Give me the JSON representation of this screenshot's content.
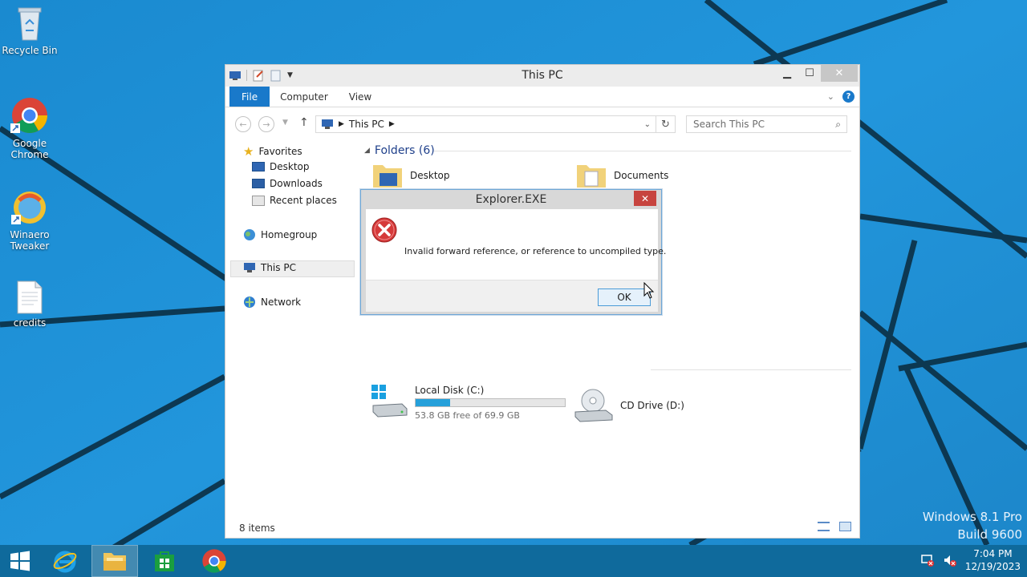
{
  "desktop": {
    "icons": [
      {
        "label": "Recycle Bin",
        "icon": "recycle-bin-icon"
      },
      {
        "label": "Google Chrome",
        "icon": "chrome-icon"
      },
      {
        "label": "Winaero Tweaker",
        "icon": "winaero-tweaker-icon"
      },
      {
        "label": "credits",
        "icon": "text-document-icon"
      }
    ],
    "watermark": {
      "line1": "Windows 8.1 Pro",
      "line2": "Build 9600"
    },
    "colors": {
      "background": "#1f8fd4",
      "lines": "#0a2a3a"
    }
  },
  "explorer": {
    "title": "This PC",
    "ribbon_tabs": [
      "File",
      "Computer",
      "View"
    ],
    "address": {
      "location": "This PC"
    },
    "search": {
      "placeholder": "Search This PC"
    },
    "nav": {
      "favorites": "Favorites",
      "desktop": "Desktop",
      "downloads": "Downloads",
      "recent": "Recent places",
      "homegroup": "Homegroup",
      "thispc": "This PC",
      "network": "Network"
    },
    "folders_header": "Folders (6)",
    "folders": [
      "Desktop",
      "Documents"
    ],
    "drives": [
      {
        "name": "Local Disk (C:)",
        "free_text": "53.8 GB free of 69.9 GB",
        "used_fraction": 0.23
      },
      {
        "name": "CD Drive (D:)"
      }
    ],
    "status": "8 items",
    "accent": "#1979ca"
  },
  "dialog": {
    "title": "Explorer.EXE",
    "message": "Invalid forward reference, or reference to uncompiled type.",
    "ok_label": "OK",
    "icon": "error-icon"
  },
  "taskbar": {
    "buttons": [
      "start-icon",
      "internet-explorer-icon",
      "file-explorer-icon",
      "store-icon",
      "chrome-icon"
    ],
    "time": "7:04 PM",
    "date": "12/19/2023"
  }
}
